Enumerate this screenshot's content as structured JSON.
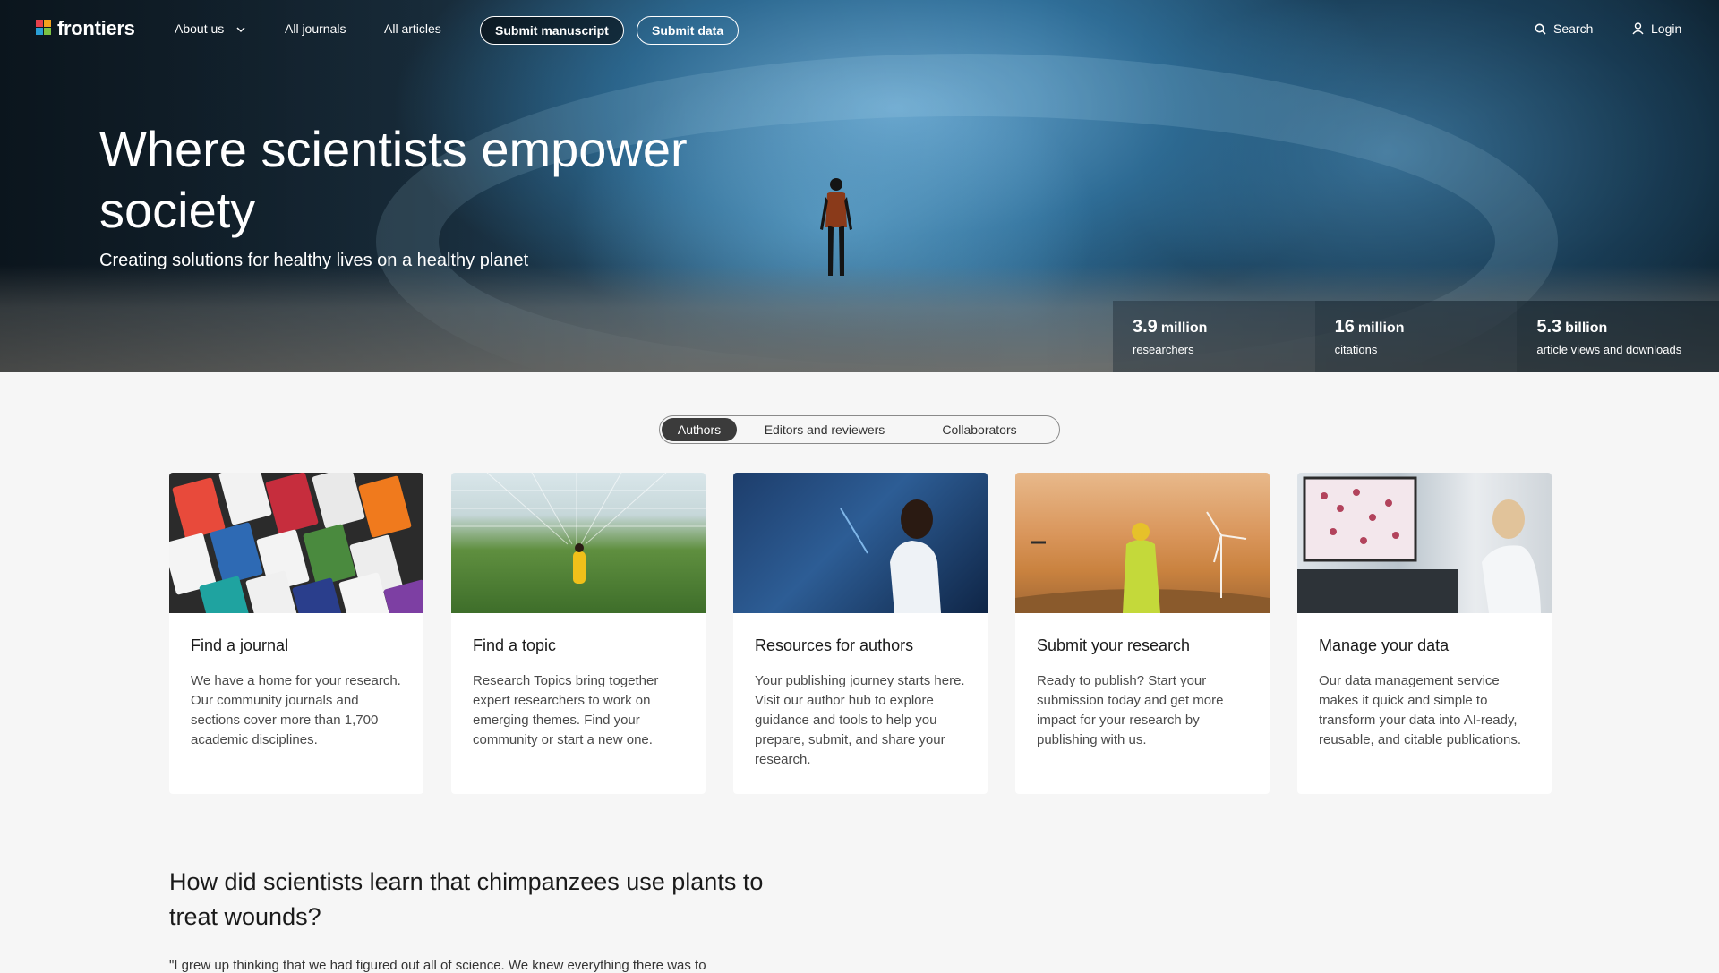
{
  "nav": {
    "logo_text": "frontiers",
    "about_label": "About us",
    "journals_label": "All journals",
    "articles_label": "All articles",
    "submit_manuscript_label": "Submit manuscript",
    "submit_data_label": "Submit data",
    "search_label": "Search",
    "login_label": "Login"
  },
  "hero": {
    "title": "Where scientists empower society",
    "subtitle": "Creating solutions for healthy lives on a healthy planet"
  },
  "stats": [
    {
      "number": "3.9",
      "unit": "million",
      "label": "researchers"
    },
    {
      "number": "16",
      "unit": "million",
      "label": "citations"
    },
    {
      "number": "5.3",
      "unit": "billion",
      "label": "article views and downloads"
    }
  ],
  "tabs": [
    {
      "label": "Authors",
      "active": true
    },
    {
      "label": "Editors and reviewers",
      "active": false
    },
    {
      "label": "Collaborators",
      "active": false
    }
  ],
  "cards": [
    {
      "title": "Find a journal",
      "text": "We have a home for your research. Our community journals and sections cover more than 1,700 academic disciplines."
    },
    {
      "title": "Find a topic",
      "text": "Research Topics bring together expert researchers to work on emerging themes. Find your community or start a new one."
    },
    {
      "title": "Resources for authors",
      "text": "Your publishing journey starts here. Visit our author hub to explore guidance and tools to help you prepare, submit, and share your research."
    },
    {
      "title": "Submit your research",
      "text": "Ready to publish? Start your submission today and get more impact for your research by publishing with us."
    },
    {
      "title": "Manage your data",
      "text": "Our data management service makes it quick and simple to transform your data into AI-ready, reusable, and citable publications."
    }
  ],
  "story": {
    "title": "How did scientists learn that chimpanzees use plants to treat wounds?",
    "quote": "\"I grew up thinking that we had figured out all of science. We knew everything there was to"
  },
  "colors": {
    "accent_dark": "#3b3b3b",
    "page_bg": "#f6f6f6"
  }
}
